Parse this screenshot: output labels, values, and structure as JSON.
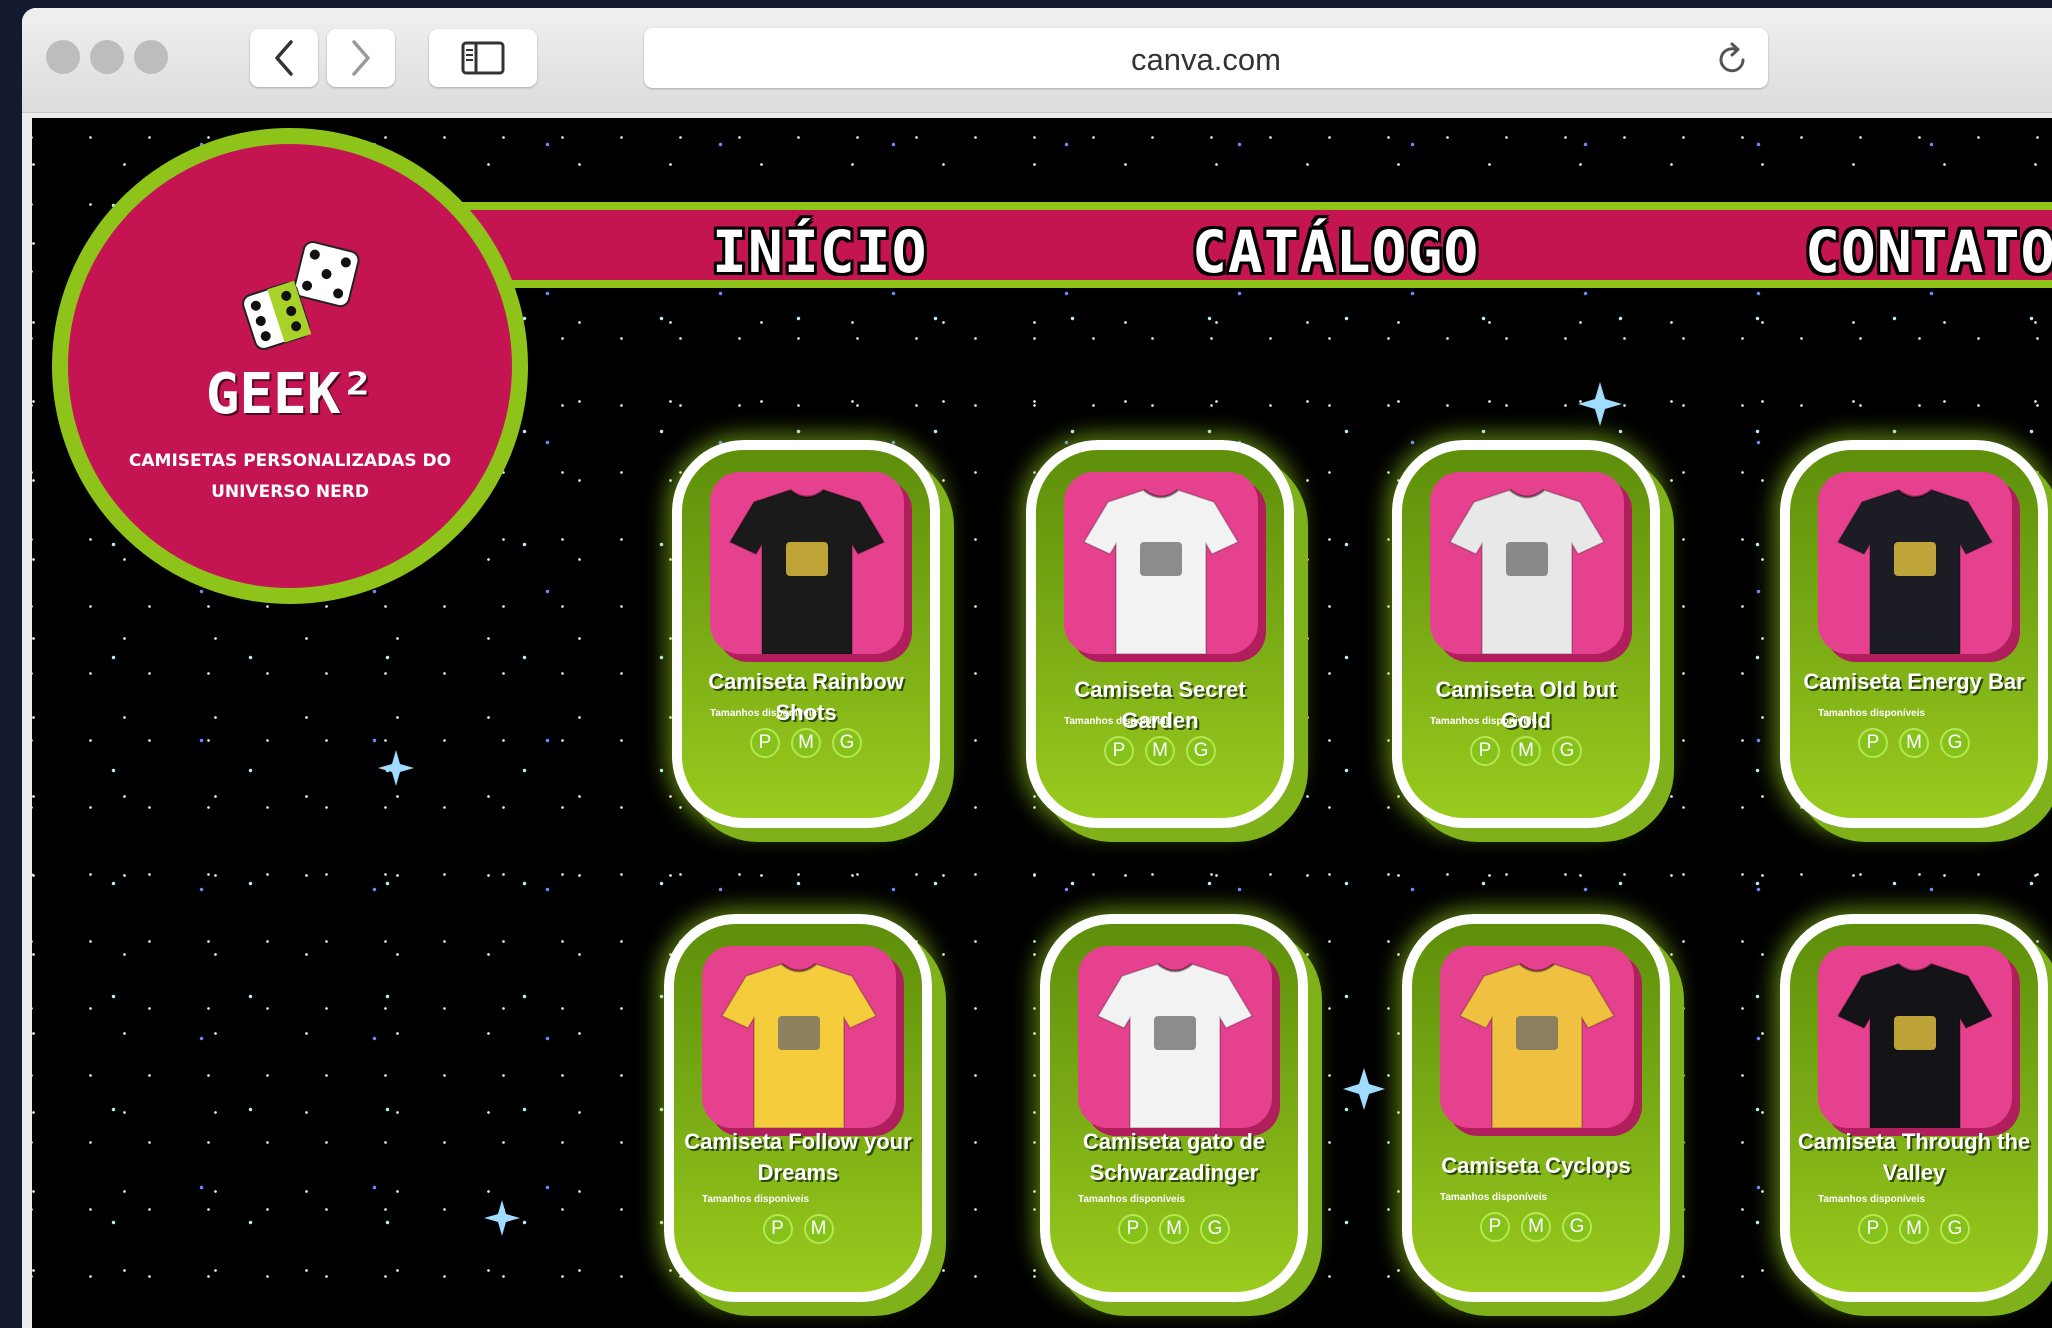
{
  "browser": {
    "url": "canva.com"
  },
  "logo": {
    "brand": "GEEK²",
    "tagline": "CAMISETAS PERSONALIZADAS DO UNIVERSO NERD"
  },
  "nav": {
    "inicio": "INÍCIO",
    "catalogo": "CATÁLOGO",
    "contato": "CONTATO"
  },
  "sizes_label": "Tamanhos disponíveis",
  "products": [
    {
      "name": "Camiseta Rainbow Shots",
      "sizes": [
        "P",
        "M",
        "G"
      ],
      "shirt_color": "#1a1a1a"
    },
    {
      "name": "Camiseta Secret Garden",
      "sizes": [
        "P",
        "M",
        "G"
      ],
      "shirt_color": "#f2f2f2"
    },
    {
      "name": "Camiseta Old but Gold",
      "sizes": [
        "P",
        "M",
        "G"
      ],
      "shirt_color": "#e8e8e8"
    },
    {
      "name": "Camiseta Energy Bar",
      "sizes": [
        "P",
        "M",
        "G"
      ],
      "shirt_color": "#1c1c24"
    },
    {
      "name": "Camiseta Follow your Dreams",
      "sizes": [
        "P",
        "M"
      ],
      "shirt_color": "#f4cc3c"
    },
    {
      "name": "Camiseta gato de Schwarzadinger",
      "sizes": [
        "P",
        "M",
        "G"
      ],
      "shirt_color": "#f2f2f2"
    },
    {
      "name": "Camiseta Cyclops",
      "sizes": [
        "P",
        "M",
        "G"
      ],
      "shirt_color": "#f0c040"
    },
    {
      "name": "Camiseta Through the Valley",
      "sizes": [
        "P",
        "M",
        "G"
      ],
      "shirt_color": "#141418"
    }
  ],
  "colors": {
    "magenta": "#c41552",
    "lime": "#8ec41a",
    "photo_pink": "#e6418e"
  }
}
